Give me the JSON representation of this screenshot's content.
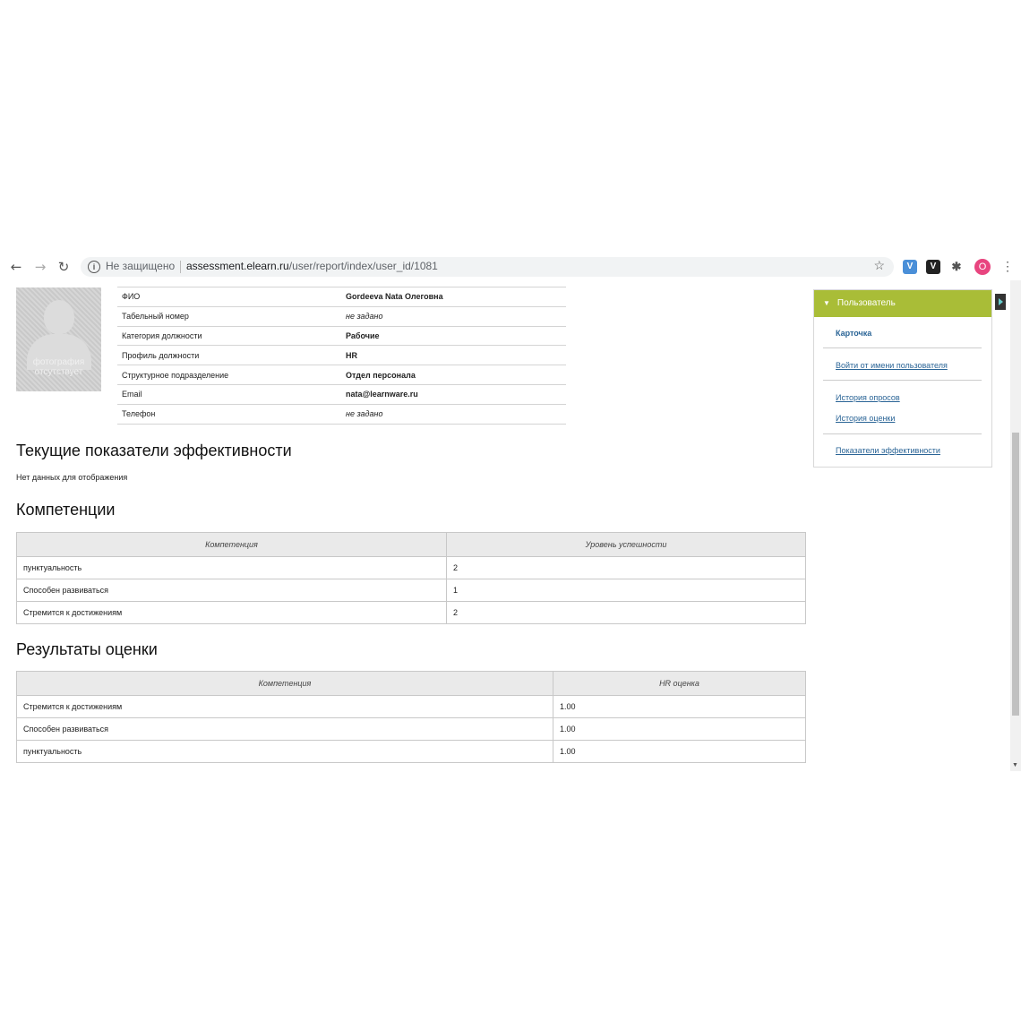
{
  "browser": {
    "security_label": "Не защищено",
    "url_domain": "assessment.elearn.ru",
    "url_path": "/user/report/index/user_id/1081",
    "avatar_letter": "O"
  },
  "photo": {
    "line1": "фотография",
    "line2": "отсутствует"
  },
  "profile": [
    {
      "label": "ФИО",
      "value": "Gordeeva Nata Олеговна"
    },
    {
      "label": "Табельный номер",
      "value": "не задано"
    },
    {
      "label": "Категория должности",
      "value": "Рабочие"
    },
    {
      "label": "Профиль должности",
      "value": "HR"
    },
    {
      "label": "Структурное подразделение",
      "value": "Отдел персонала"
    },
    {
      "label": "Email",
      "value": "nata@learnware.ru"
    },
    {
      "label": "Телефон",
      "value": "не задано"
    }
  ],
  "kpi": {
    "title": "Текущие показатели эффективности",
    "empty": "Нет данных для отображения"
  },
  "competencies": {
    "title": "Компетенции",
    "headers": [
      "Компетенция",
      "Уровень успешности"
    ],
    "rows": [
      [
        "пунктуальность",
        "2"
      ],
      [
        "Способен развиваться",
        "1"
      ],
      [
        "Стремится к достижениям",
        "2"
      ]
    ]
  },
  "results": {
    "title": "Результаты оценки",
    "headers": [
      "Компетенция",
      "HR оценка"
    ],
    "rows": [
      [
        "Стремится к достижениям",
        "1.00"
      ],
      [
        "Способен развиваться",
        "1.00"
      ],
      [
        "пунктуальность",
        "1.00"
      ]
    ]
  },
  "sidebar": {
    "header": "Пользователь",
    "items": [
      "Карточка",
      "Войти от имени пользователя",
      "История опросов",
      "История оценки",
      "Показатели эффективности"
    ]
  },
  "colors": {
    "accent": "#a9bd37",
    "link": "#2a6496"
  }
}
